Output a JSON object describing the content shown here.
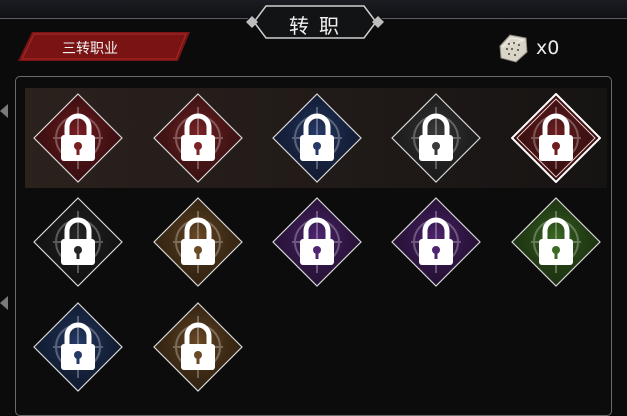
{
  "header": {
    "title": "转职"
  },
  "category": {
    "label": "三转职业"
  },
  "currency": {
    "icon": "scroll-stone-icon",
    "count": "x0"
  },
  "class_slots": [
    {
      "id": 1,
      "color": "#7a1e22",
      "locked": true
    },
    {
      "id": 2,
      "color": "#7b2426",
      "locked": true
    },
    {
      "id": 3,
      "color": "#263a69",
      "locked": true
    },
    {
      "id": 4,
      "color": "#3a3a3a",
      "locked": true
    },
    {
      "id": 5,
      "color": "#6f1e20",
      "locked": true,
      "selected": true
    },
    {
      "id": 6,
      "color": "#262626",
      "locked": true
    },
    {
      "id": 7,
      "color": "#6b4a25",
      "locked": true
    },
    {
      "id": 8,
      "color": "#512673",
      "locked": true
    },
    {
      "id": 9,
      "color": "#4f2470",
      "locked": true
    },
    {
      "id": 10,
      "color": "#3c6a24",
      "locked": true
    },
    {
      "id": 11,
      "color": "#253a66",
      "locked": true
    },
    {
      "id": 12,
      "color": "#6b4a26",
      "locked": true
    }
  ]
}
